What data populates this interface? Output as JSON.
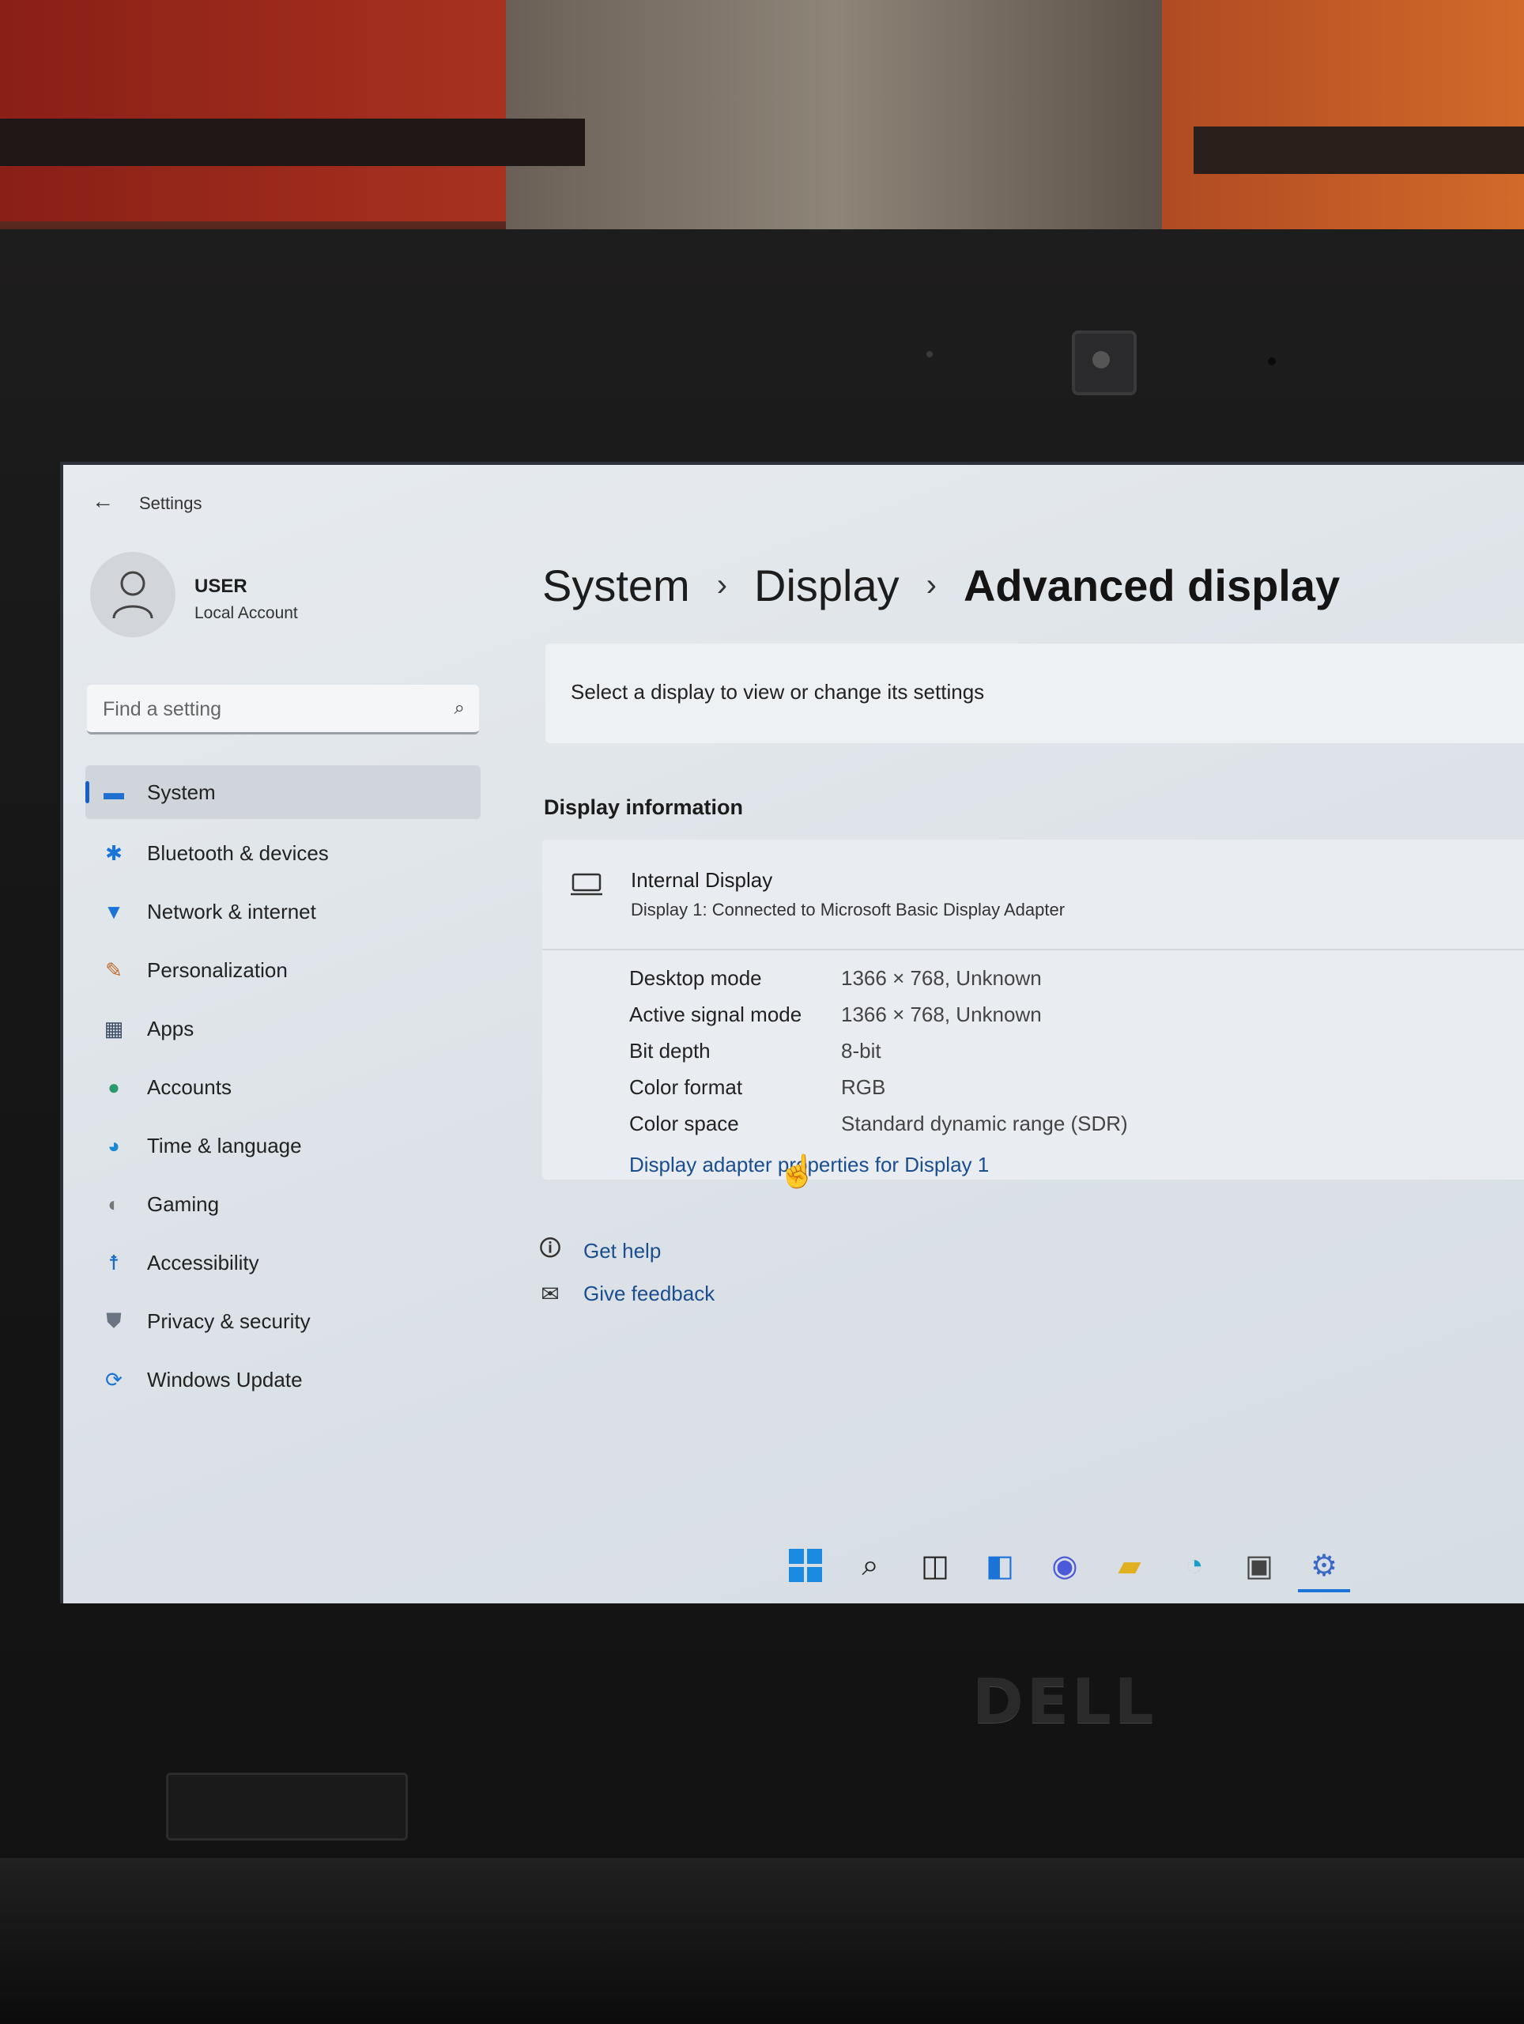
{
  "window": {
    "title": "Settings"
  },
  "user": {
    "name": "USER",
    "account_type": "Local Account"
  },
  "search": {
    "placeholder": "Find a setting"
  },
  "sidebar": {
    "items": [
      {
        "label": "System",
        "icon": "system-icon",
        "active": true
      },
      {
        "label": "Bluetooth & devices",
        "icon": "bluetooth-icon"
      },
      {
        "label": "Network & internet",
        "icon": "wifi-icon"
      },
      {
        "label": "Personalization",
        "icon": "brush-icon"
      },
      {
        "label": "Apps",
        "icon": "apps-icon"
      },
      {
        "label": "Accounts",
        "icon": "accounts-icon"
      },
      {
        "label": "Time & language",
        "icon": "globe-clock-icon"
      },
      {
        "label": "Gaming",
        "icon": "gamepad-icon"
      },
      {
        "label": "Accessibility",
        "icon": "accessibility-icon"
      },
      {
        "label": "Privacy & security",
        "icon": "shield-icon"
      },
      {
        "label": "Windows Update",
        "icon": "update-icon"
      }
    ]
  },
  "breadcrumb": {
    "level1": "System",
    "level2": "Display",
    "current": "Advanced display",
    "separator": "›"
  },
  "display_select": {
    "text": "Select a display to view or change its settings"
  },
  "display_info": {
    "section_title": "Display information",
    "name": "Internal Display",
    "subtitle": "Display 1: Connected to Microsoft Basic Display Adapter",
    "rows": [
      {
        "label": "Desktop mode",
        "value": "1366 × 768, Unknown"
      },
      {
        "label": "Active signal mode",
        "value": "1366 × 768, Unknown"
      },
      {
        "label": "Bit depth",
        "value": "8-bit"
      },
      {
        "label": "Color format",
        "value": "RGB"
      },
      {
        "label": "Color space",
        "value": "Standard dynamic range (SDR)"
      }
    ],
    "adapter_link": "Display adapter properties for Display 1"
  },
  "help": {
    "get_help": "Get help",
    "give_feedback": "Give feedback"
  },
  "taskbar": {
    "icons": [
      "windows-start-icon",
      "search-icon",
      "task-view-icon",
      "widgets-icon",
      "chat-icon",
      "file-explorer-icon",
      "edge-icon",
      "store-icon",
      "settings-icon"
    ]
  },
  "laptop": {
    "brand": "DELL"
  },
  "colors": {
    "accent": "#1761c4",
    "link": "#1b4e8f",
    "screen_bg": "#e2e7ec"
  }
}
